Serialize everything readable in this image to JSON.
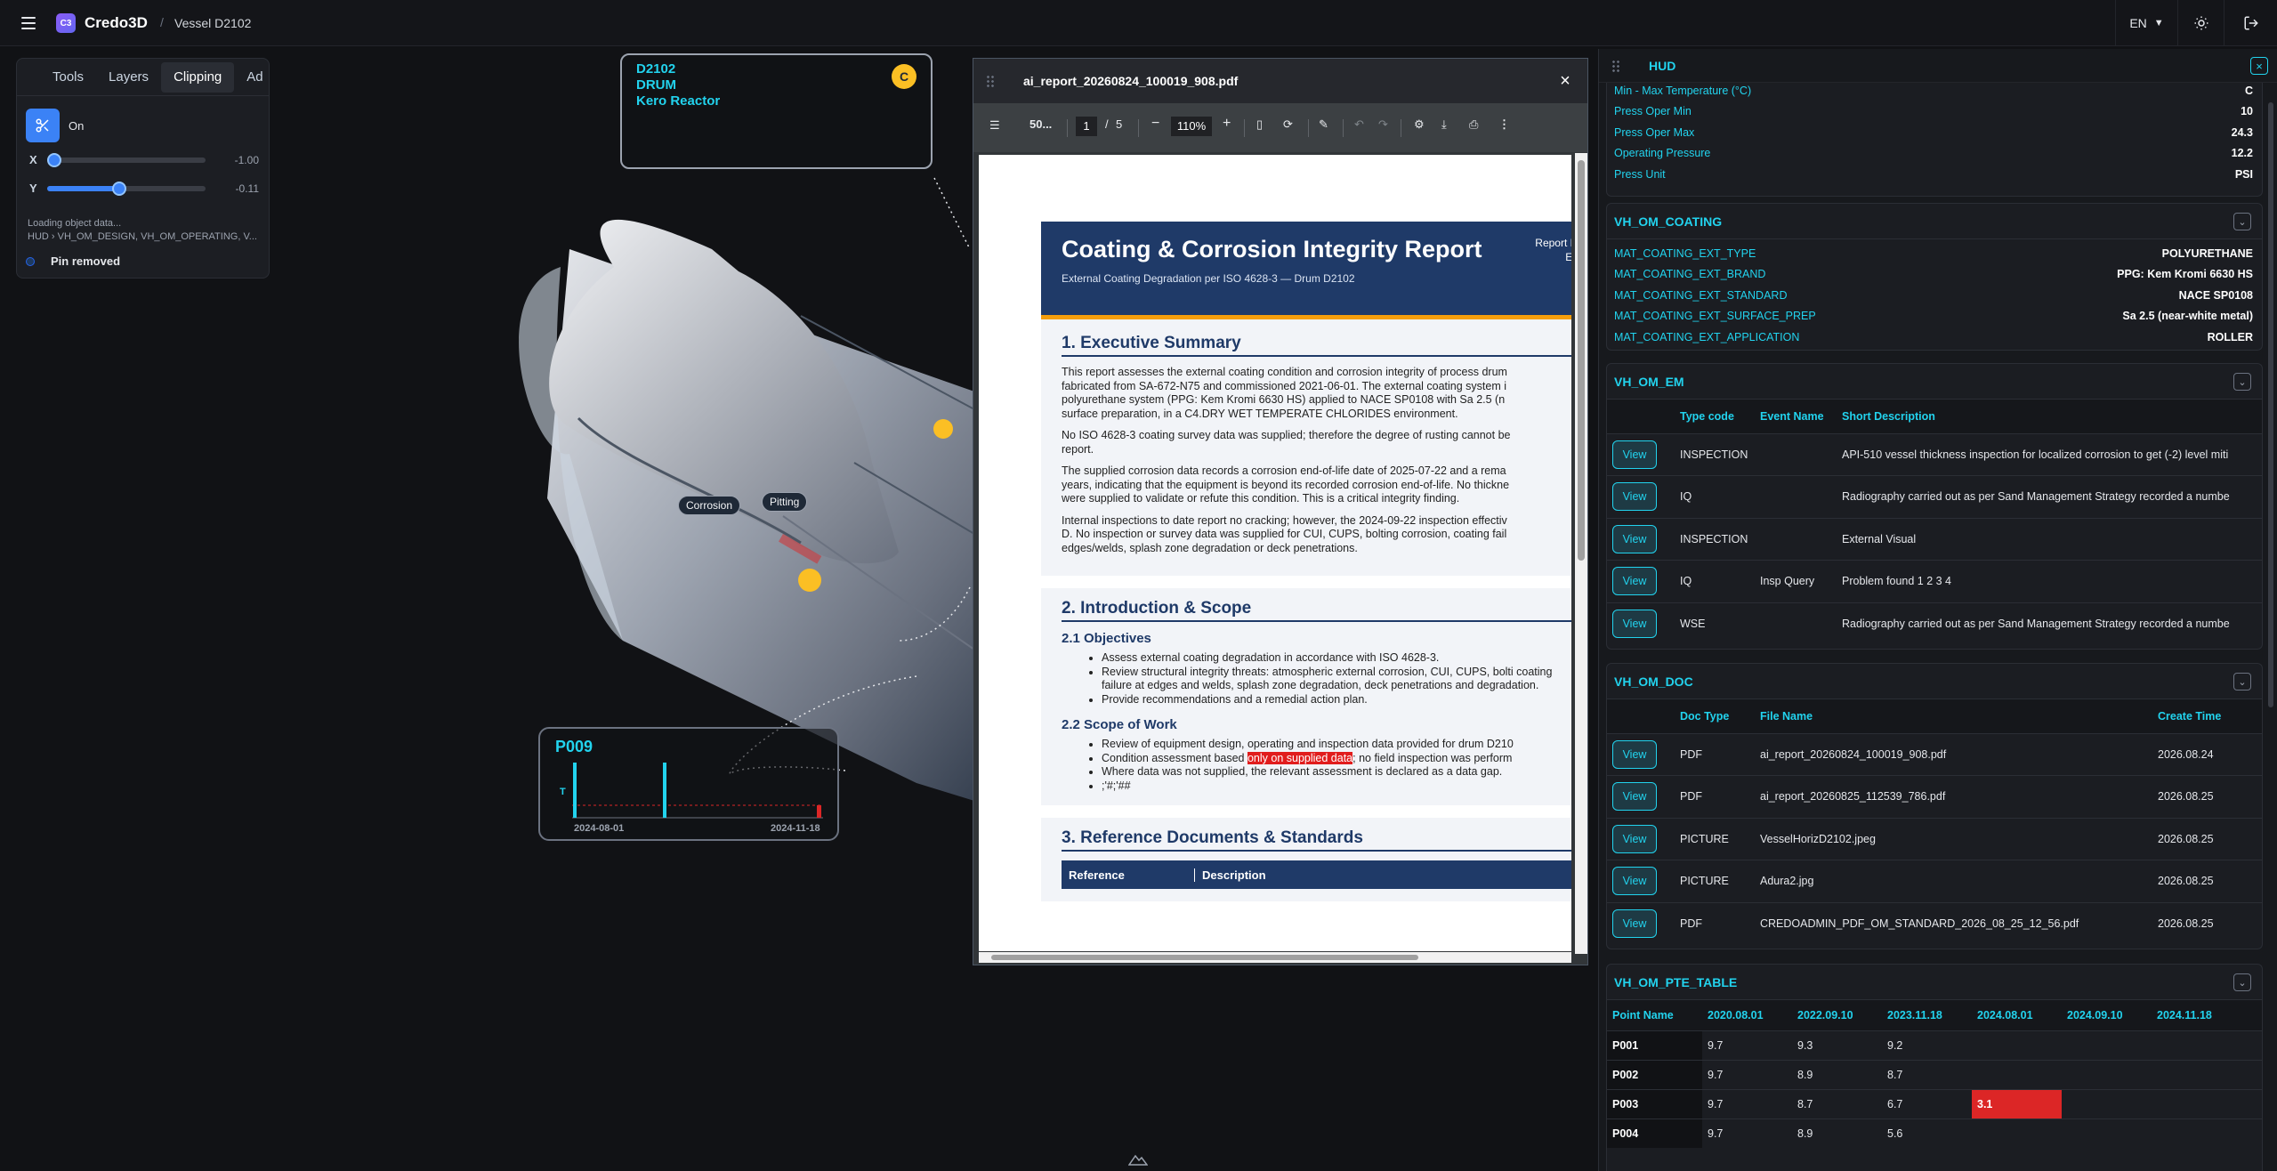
{
  "app": {
    "name": "Credo3D",
    "logo_text": "C3",
    "breadcrumb_sep": "/",
    "breadcrumb": "Vessel D2102",
    "language": "EN"
  },
  "clipping": {
    "tabs": [
      "Tools",
      "Layers",
      "Clipping",
      "Ad"
    ],
    "active_tab": "Clipping",
    "toggle_label": "On",
    "x_label": "X",
    "x_value": "-1.00",
    "x_fraction": 0.0,
    "y_label": "Y",
    "y_value": "-0.11",
    "y_fraction": 0.45,
    "loading_line1": "Loading object data...",
    "loading_line2": "HUD › VH_OM_DESIGN, VH_OM_OPERATING, V...",
    "pin_status": "Pin removed"
  },
  "tag": {
    "line1": "D2102",
    "line2": "DRUM",
    "line3": "Kero Reactor",
    "badge": "C"
  },
  "callouts": {
    "corrosion": "Corrosion",
    "pitting": "Pitting"
  },
  "p_card": {
    "title": "P009",
    "axis_label": "T",
    "date_start": "2024-08-01",
    "date_end": "2024-11-18"
  },
  "pdf": {
    "filename": "ai_report_20260824_100019_908.pdf",
    "doc_label": "50...",
    "page_current": "1",
    "page_sep": "/",
    "page_total": "5",
    "zoom": "110%",
    "zoom_minus": "−",
    "zoom_plus": "+",
    "doc": {
      "title": "Coating & Corrosion Integrity Report",
      "subtitle": "External Coating Degradation per ISO 4628-3 — Drum D2102",
      "meta1": "Report Date",
      "meta2": "Equip",
      "s1_title": "1. Executive Summary",
      "s1_p1a": "This report assesses the external coating condition and corrosion integrity of process drum",
      "s1_p1b": "fabricated from SA-672-N75 and commissioned 2021-06-01. The external coating system i",
      "s1_p1c": "polyurethane system (PPG: Kem Kromi 6630 HS) applied to NACE SP0108 with Sa 2.5 (n",
      "s1_p1d": "surface preparation, in a C4.DRY WET TEMPERATE CHLORIDES environment.",
      "s1_p2a": "No ISO 4628-3 coating survey data was supplied; therefore the degree of rusting cannot be",
      "s1_p2b": "report.",
      "s1_p3a": "The supplied corrosion data records a corrosion end-of-life date of 2025-07-22 and a rema",
      "s1_p3b": "years, indicating that the equipment is beyond its recorded corrosion end-of-life. No thickne",
      "s1_p3c": "were supplied to validate or refute this condition. This is a critical integrity finding.",
      "s1_p4a": "Internal inspections to date report no cracking; however, the 2024-09-22 inspection effectiv",
      "s1_p4b": "D. No inspection or survey data was supplied for CUI, CUPS, bolting corrosion, coating fail",
      "s1_p4c": "edges/welds, splash zone degradation or deck penetrations.",
      "s2_title": "2. Introduction & Scope",
      "s21_title": "2.1 Objectives",
      "s21_items": [
        "Assess external coating degradation in accordance with ISO 4628-3.",
        "Review structural integrity threats: atmospheric external corrosion, CUI, CUPS, bolti coating failure at edges and welds, splash zone degradation, deck penetrations and degradation.",
        "Provide recommendations and a remedial action plan."
      ],
      "s22_title": "2.2 Scope of Work",
      "s22_item1": "Review of equipment design, operating and inspection data provided for drum D210",
      "s22_item2a": "Condition assessment based ",
      "s22_item2b": "only on supplied data",
      "s22_item2c": "; no field inspection was perform",
      "s22_item3": "Where data was not supplied, the relevant assessment is declared as a data gap.",
      "s22_item4": ";'#;'##",
      "s3_title": "3. Reference Documents & Standards",
      "s3_col1": "Reference",
      "s3_col2": "Description"
    }
  },
  "hud": {
    "title": "HUD",
    "operating_rows": [
      {
        "k": "Min - Max Temperature (°C)",
        "v": "C"
      },
      {
        "k": "Press Oper Min",
        "v": "10"
      },
      {
        "k": "Press Oper Max",
        "v": "24.3"
      },
      {
        "k": "Operating Pressure",
        "v": "12.2"
      },
      {
        "k": "Press Unit",
        "v": "PSI"
      }
    ],
    "coating": {
      "title": "VH_OM_COATING",
      "rows": [
        {
          "k": "MAT_COATING_EXT_TYPE",
          "v": "POLYURETHANE"
        },
        {
          "k": "MAT_COATING_EXT_BRAND",
          "v": "PPG: Kem Kromi 6630 HS"
        },
        {
          "k": "MAT_COATING_EXT_STANDARD",
          "v": "NACE SP0108"
        },
        {
          "k": "MAT_COATING_EXT_SURFACE_PREP",
          "v": "Sa 2.5 (near-white metal)"
        },
        {
          "k": "MAT_COATING_EXT_APPLICATION",
          "v": "ROLLER"
        }
      ]
    },
    "em": {
      "title": "VH_OM_EM",
      "headers": [
        "",
        "Type code",
        "Event Name",
        "Short Description"
      ],
      "view_label": "View",
      "rows": [
        {
          "type": "INSPECTION",
          "event": "",
          "desc": "API-510 vessel thickness inspection for localized corrosion to get (-2) level miti"
        },
        {
          "type": "IQ",
          "event": "",
          "desc": "Radiography carried out as per Sand Management Strategy recorded a numbe"
        },
        {
          "type": "INSPECTION",
          "event": "",
          "desc": "External Visual"
        },
        {
          "type": "IQ",
          "event": "Insp Query",
          "desc": "Problem found 1 2 3 4"
        },
        {
          "type": "WSE",
          "event": "",
          "desc": "Radiography carried out as per Sand Management Strategy recorded a numbe"
        }
      ]
    },
    "doc": {
      "title": "VH_OM_DOC",
      "headers": [
        "",
        "Doc Type",
        "File Name",
        "Create Time"
      ],
      "view_label": "View",
      "rows": [
        {
          "type": "PDF",
          "file": "ai_report_20260824_100019_908.pdf",
          "time": "2026.08.24"
        },
        {
          "type": "PDF",
          "file": "ai_report_20260825_112539_786.pdf",
          "time": "2026.08.25"
        },
        {
          "type": "PICTURE",
          "file": "VesselHorizD2102.jpeg",
          "time": "2026.08.25"
        },
        {
          "type": "PICTURE",
          "file": "Adura2.jpg",
          "time": "2026.08.25"
        },
        {
          "type": "PDF",
          "file": "CREDOADMIN_PDF_OM_STANDARD_2026_08_25_12_56.pdf",
          "time": "2026.08.25"
        }
      ]
    },
    "pte": {
      "title": "VH_OM_PTE_TABLE",
      "headers": [
        "Point Name",
        "2020.08.01",
        "2022.09.10",
        "2023.11.18",
        "2024.08.01",
        "2024.09.10",
        "2024.11.18"
      ],
      "rows": [
        {
          "name": "P001",
          "vals": [
            "9.7",
            "9.3",
            "9.2",
            "",
            "",
            ""
          ]
        },
        {
          "name": "P002",
          "vals": [
            "9.7",
            "8.9",
            "8.7",
            "",
            "",
            ""
          ]
        },
        {
          "name": "P003",
          "vals": [
            "9.7",
            "8.7",
            "6.7",
            "3.1",
            "",
            ""
          ]
        },
        {
          "name": "P004",
          "vals": [
            "9.7",
            "8.9",
            "5.6",
            "",
            "",
            ""
          ]
        }
      ]
    }
  },
  "colors": {
    "accent": "#22d3ee",
    "brand": "#6366f1",
    "badge": "#fbbf24",
    "alert": "#dc2626",
    "toggle_on": "#3b82f6"
  }
}
